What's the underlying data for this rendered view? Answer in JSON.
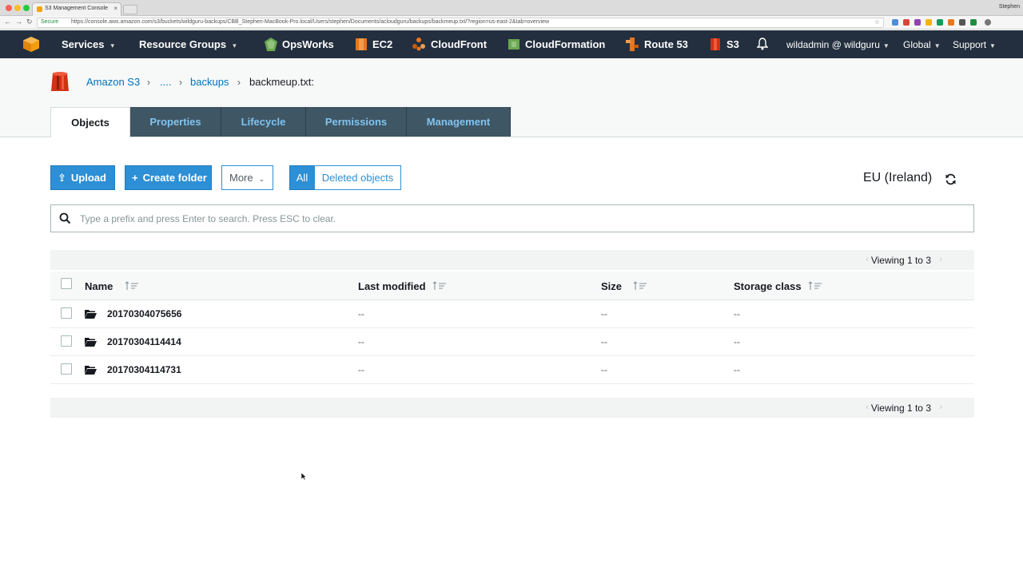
{
  "browser": {
    "tab_title": "S3 Management Console",
    "profile": "Stephen",
    "secure_label": "Secure",
    "url": "https://console.aws.amazon.com/s3/buckets/wildguru-backups/CBB_Stephen-MacBook-Pro.local/Users/stephen/Documents/acloudguru/backups/backmeup.txt/?region=us-east-2&tab=overview"
  },
  "topnav": {
    "services": "Services",
    "resource_groups": "Resource Groups",
    "shortcuts": [
      {
        "label": "OpsWorks",
        "icon": "opsworks-icon",
        "color": "#6aa84f"
      },
      {
        "label": "EC2",
        "icon": "ec2-icon",
        "color": "#e8761f"
      },
      {
        "label": "CloudFront",
        "icon": "cloudfront-icon",
        "color": "#e8761f"
      },
      {
        "label": "CloudFormation",
        "icon": "cloudformation-icon",
        "color": "#6aa84f"
      },
      {
        "label": "Route 53",
        "icon": "route53-icon",
        "color": "#e8761f"
      },
      {
        "label": "S3",
        "icon": "s3-icon",
        "color": "#d13212"
      }
    ],
    "account": "wildadmin @ wildguru",
    "region": "Global",
    "support": "Support"
  },
  "breadcrumb": {
    "root": "Amazon S3",
    "ellipsis": "....",
    "folder": "backups",
    "current": "backmeup.txt:"
  },
  "tabs": [
    "Objects",
    "Properties",
    "Lifecycle",
    "Permissions",
    "Management"
  ],
  "active_tab": "Objects",
  "toolbar": {
    "upload": "Upload",
    "create_folder": "Create folder",
    "more": "More",
    "all": "All",
    "deleted_objects": "Deleted objects",
    "region": "EU (Ireland)"
  },
  "search": {
    "placeholder": "Type a prefix and press Enter to search. Press ESC to clear.",
    "value": ""
  },
  "table": {
    "viewing": "Viewing 1 to 3",
    "columns": [
      "Name",
      "Last modified",
      "Size",
      "Storage class"
    ],
    "rows": [
      {
        "name": "20170304075656",
        "last_modified": "--",
        "size": "--",
        "storage_class": "--"
      },
      {
        "name": "20170304114414",
        "last_modified": "--",
        "size": "--",
        "storage_class": "--"
      },
      {
        "name": "20170304114731",
        "last_modified": "--",
        "size": "--",
        "storage_class": "--"
      }
    ]
  },
  "colors": {
    "nav_bg": "#232f3e",
    "primary_blue": "#2d8fd5",
    "link_blue": "#0073bb",
    "tab_bg": "#3f5665"
  }
}
